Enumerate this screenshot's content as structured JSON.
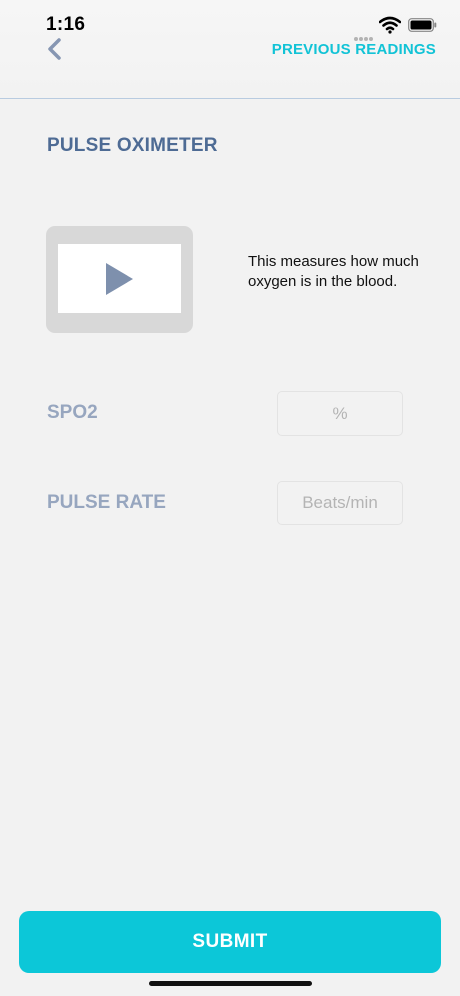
{
  "status_bar": {
    "time": "1:16"
  },
  "header": {
    "back_icon": "chevron-left-icon",
    "previous_readings_label": "PREVIOUS READINGS"
  },
  "page": {
    "title": "PULSE OXIMETER",
    "video": {
      "icon": "play-icon"
    },
    "description": "This measures how much oxygen is in the blood."
  },
  "fields": {
    "spo2": {
      "label": "SPO2",
      "value": "",
      "placeholder": "%"
    },
    "pulse_rate": {
      "label": "PULSE RATE",
      "value": "",
      "placeholder": "Beats/min"
    }
  },
  "submit_label": "SUBMIT",
  "colors": {
    "accent": "#0cc7d8",
    "title": "#4e6b94",
    "label": "#97a6bf",
    "background": "#f2f2f2"
  }
}
